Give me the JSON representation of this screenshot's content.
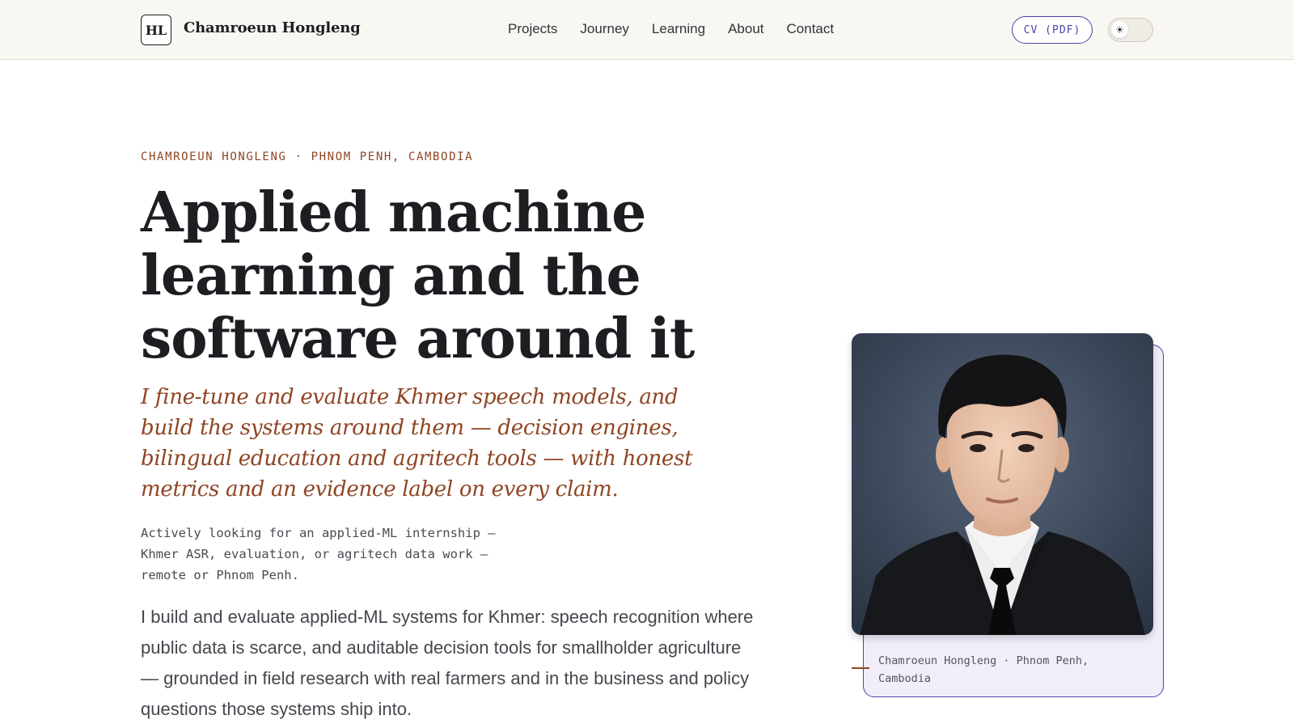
{
  "header": {
    "logo_text": "HL",
    "brand_name": "Chamroeun Hongleng",
    "nav": [
      {
        "label": "Projects"
      },
      {
        "label": "Journey"
      },
      {
        "label": "Learning"
      },
      {
        "label": "About"
      },
      {
        "label": "Contact"
      }
    ],
    "cv_button": "CV (PDF)",
    "theme_toggle_icon": "☀",
    "theme_toggle_icon_name": "sun-icon"
  },
  "hero": {
    "eyebrow": "CHAMROEUN HONGLENG · PHNOM PENH, CAMBODIA",
    "headline": "Applied machine learning and the software around it",
    "subhead": "I fine-tune and evaluate Khmer speech models, and build the systems around them — decision engines, bilingual education and agritech tools — with honest metrics and an evidence label on every claim.",
    "availability": "Actively looking for an applied-ML internship — Khmer ASR, evaluation, or agritech data work — remote or Phnom Penh.",
    "intro": "I build and evaluate applied-ML systems for Khmer: speech recognition where public data is scarce, and auditable decision tools for smallholder agriculture — grounded in field research with real farmers and in the business and policy questions those systems ship into."
  },
  "portrait": {
    "caption": "Chamroeun Hongleng · Phnom Penh, Cambodia"
  },
  "colors": {
    "accent_rust": "#8f4523",
    "accent_indigo": "#4b44a8",
    "header_bg": "#f9f7f2",
    "text_dark": "#1d1d22"
  }
}
